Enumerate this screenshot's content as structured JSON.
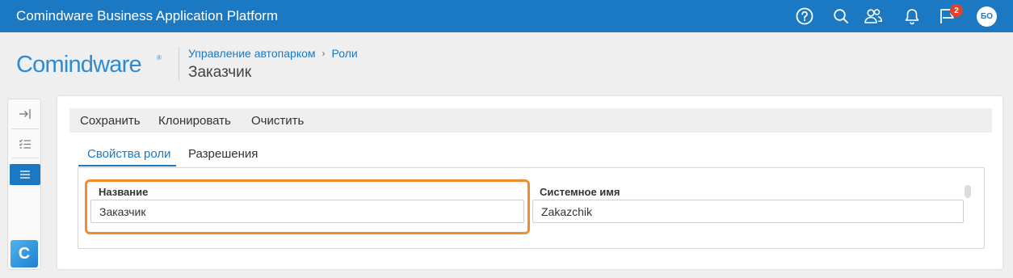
{
  "app": {
    "title": "Comindware Business Application Platform"
  },
  "header": {
    "icons": [
      "help-icon",
      "search-icon",
      "users-icon",
      "bell-icon",
      "flag-icon"
    ],
    "notification_count": "2",
    "avatar_initials": "БО"
  },
  "brand": {
    "logo_text": "Comindware",
    "registered": "®"
  },
  "breadcrumb": {
    "items": [
      "Управление автопарком",
      "Роли"
    ],
    "separator": "›"
  },
  "page": {
    "title": "Заказчик"
  },
  "toolbar": {
    "save_label": "Сохранить",
    "clone_label": "Клонировать",
    "clear_label": "Очистить"
  },
  "tabs": [
    {
      "label": "Свойства роли",
      "active": true
    },
    {
      "label": "Разрешения",
      "active": false
    }
  ],
  "form": {
    "name_label": "Название",
    "name_value": "Заказчик",
    "system_name_label": "Системное имя",
    "system_name_value": "Zakazchik"
  },
  "sidebar": {
    "items": [
      {
        "icon": "collapse-arrow-icon"
      },
      {
        "icon": "task-list-icon"
      },
      {
        "icon": "menu-icon",
        "active": true
      }
    ],
    "app_tile": "C"
  },
  "colors": {
    "primary": "#1b78c2",
    "highlight": "#f08c32",
    "badge": "#e2412b"
  }
}
